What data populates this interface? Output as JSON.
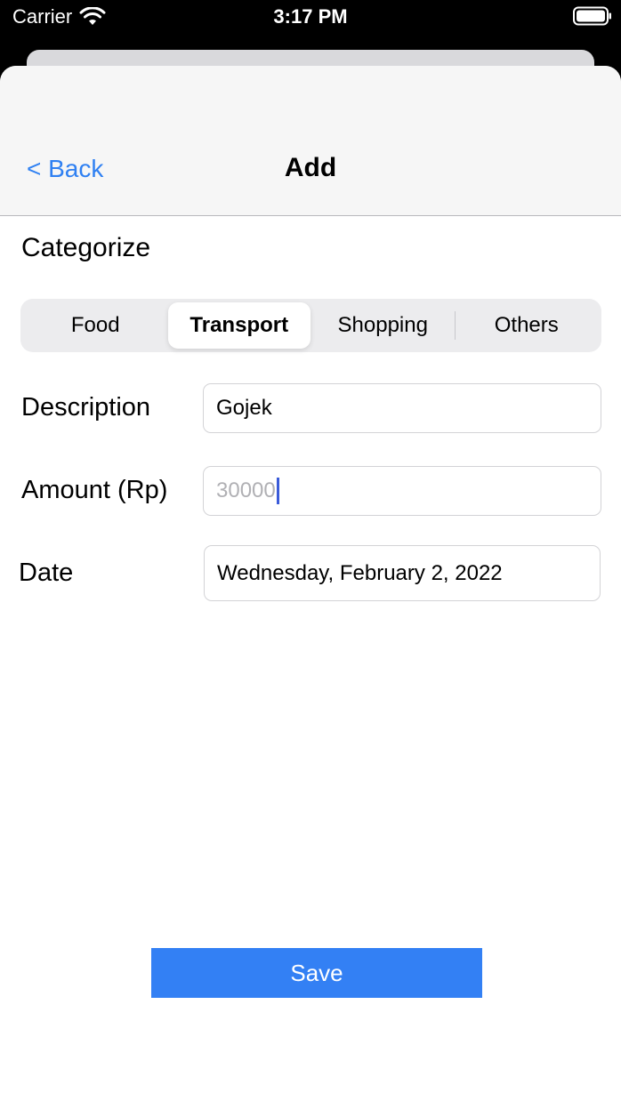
{
  "status_bar": {
    "carrier": "Carrier",
    "time": "3:17 PM"
  },
  "navbar": {
    "back_label": "< Back",
    "title": "Add"
  },
  "categorize": {
    "label": "Categorize",
    "segments": [
      "Food",
      "Transport",
      "Shopping",
      "Others"
    ],
    "selected": "Transport"
  },
  "form": {
    "description": {
      "label": "Description",
      "value": "Gojek"
    },
    "amount": {
      "label": "Amount (Rp)",
      "placeholder": "30000"
    },
    "date": {
      "label": "Date",
      "value": "Wednesday, February 2, 2022"
    }
  },
  "save_label": "Save",
  "colors": {
    "accent": "#2f80f2",
    "save_button": "#3380f4",
    "navbar_bg": "#f6f6f6",
    "segment_bg": "#ececee"
  },
  "icons": {
    "wifi": "wifi-icon",
    "battery": "battery-icon"
  }
}
